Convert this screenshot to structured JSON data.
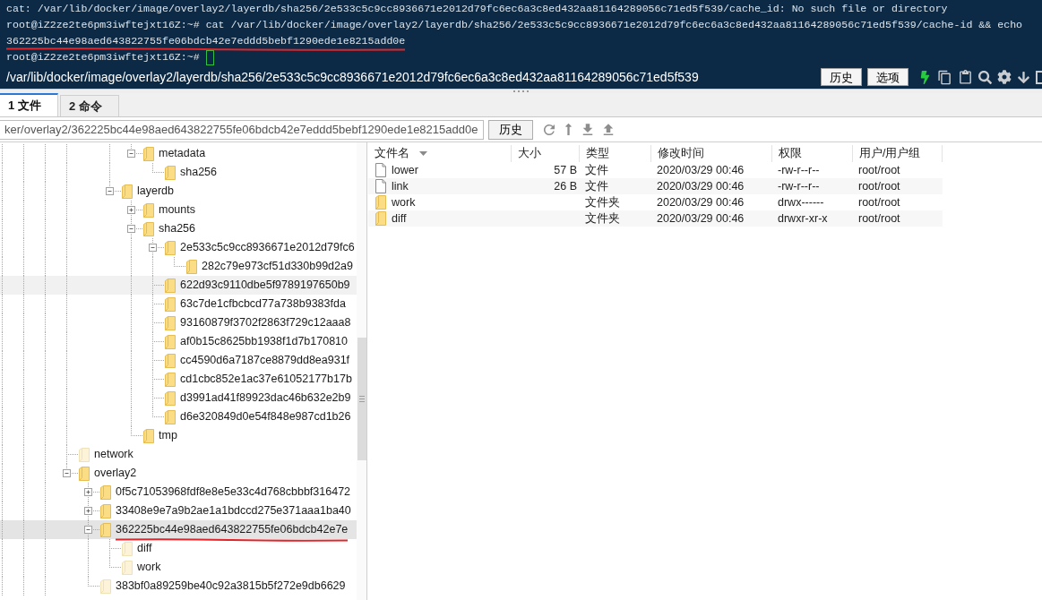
{
  "terminal": {
    "lines": [
      {
        "text": "cat: /var/lib/docker/image/overlay2/layerdb/sha256/2e533c5c9cc8936671e2012d79fc6ec6a3c8ed432aa81164289056c71ed5f539/cache_id: No such file or directory",
        "underlined": false
      },
      {
        "text": "root@iZ2ze2te6pm3iwftejxt16Z:~# cat /var/lib/docker/image/overlay2/layerdb/sha256/2e533c5c9cc8936671e2012d79fc6ec6a3c8ed432aa81164289056c71ed5f539/cache-id && echo",
        "underlined": false
      },
      {
        "text": "362225bc44e98aed643822755fe06bdcb42e7eddd5bebf1290ede1e8215add0e",
        "underlined": true
      },
      {
        "text": "root@iZ2ze2te6pm3iwftejxt16Z:~#",
        "underlined": false
      }
    ],
    "cursor": true,
    "path": "/var/lib/docker/image/overlay2/layerdb/sha256/2e533c5c9cc8936671e2012d79fc6ec6a3c8ed432aa81164289056c71ed5f539",
    "buttons": [
      "历史",
      "选项"
    ]
  },
  "tabs": [
    {
      "label": "1 文件",
      "selected": true
    },
    {
      "label": "2 命令",
      "selected": false
    }
  ],
  "path_bar": {
    "value": "ker/overlay2/362225bc44e98aed643822755fe06bdcb42e7eddd5bebf1290ede1e8215add0e",
    "button": "历史"
  },
  "tree": [
    {
      "children": [
        {
          "children": [
            {
              "children": [
                {
                  "label": "metadata",
                  "expanded": true,
                  "faded": false,
                  "selected": false,
                  "hovered": false,
                  "underlined": false,
                  "children": [
                    {
                      "label": "sha256",
                      "faded": false,
                      "selected": false,
                      "hovered": false,
                      "underlined": false
                    }
                  ]
                }
              ]
            },
            {
              "label": "layerdb",
              "expanded": true,
              "faded": false,
              "selected": false,
              "hovered": false,
              "underlined": false,
              "children": [
                {
                  "label": "mounts",
                  "expanded": false,
                  "faded": false,
                  "selected": false,
                  "hovered": false,
                  "underlined": false
                },
                {
                  "label": "sha256",
                  "expanded": true,
                  "faded": false,
                  "selected": false,
                  "hovered": false,
                  "underlined": false,
                  "children": [
                    {
                      "label": "2e533c5c9cc8936671e2012d79fc6",
                      "expanded": true,
                      "faded": false,
                      "selected": false,
                      "hovered": false,
                      "underlined": false,
                      "children": [
                        {
                          "label": "282c79e973cf51d330b99d2a9",
                          "faded": false,
                          "selected": false,
                          "hovered": false,
                          "underlined": false
                        }
                      ]
                    },
                    {
                      "label": "622d93c9110dbe5f9789197650b9",
                      "faded": false,
                      "selected": false,
                      "hovered": true,
                      "underlined": false
                    },
                    {
                      "label": "63c7de1cfbcbcd77a738b9383fda",
                      "faded": false,
                      "selected": false,
                      "hovered": false,
                      "underlined": false
                    },
                    {
                      "label": "93160879f3702f2863f729c12aaa8",
                      "faded": false,
                      "selected": false,
                      "hovered": false,
                      "underlined": false
                    },
                    {
                      "label": "af0b15c8625bb1938f1d7b170810",
                      "faded": false,
                      "selected": false,
                      "hovered": false,
                      "underlined": false
                    },
                    {
                      "label": "cc4590d6a7187ce8879dd8ea931f",
                      "faded": false,
                      "selected": false,
                      "hovered": false,
                      "underlined": false
                    },
                    {
                      "label": "cd1cbc852e1ac37e61052177b17b",
                      "faded": false,
                      "selected": false,
                      "hovered": false,
                      "underlined": false
                    },
                    {
                      "label": "d3991ad41f89923dac46b632e2b9",
                      "faded": false,
                      "selected": false,
                      "hovered": false,
                      "underlined": false
                    },
                    {
                      "label": "d6e320849d0e54f848e987cd1b26",
                      "faded": false,
                      "selected": false,
                      "hovered": false,
                      "underlined": false
                    }
                  ]
                },
                {
                  "label": "tmp",
                  "faded": false,
                  "selected": false,
                  "hovered": false,
                  "underlined": false
                }
              ]
            }
          ]
        }
      ]
    },
    {
      "label": "network",
      "faded": true,
      "selected": false,
      "hovered": false,
      "underlined": false
    },
    {
      "label": "overlay2",
      "expanded": true,
      "faded": false,
      "selected": false,
      "hovered": false,
      "underlined": false,
      "children": [
        {
          "label": "0f5c71053968fdf8e8e5e33c4d768cbbbf316472",
          "expanded": false,
          "faded": false,
          "selected": false,
          "hovered": false,
          "underlined": false
        },
        {
          "label": "33408e9e7a9b2ae1a1bdccd275e371aaa1ba40",
          "expanded": false,
          "faded": false,
          "selected": false,
          "hovered": false,
          "underlined": false
        },
        {
          "label": "362225bc44e98aed643822755fe06bdcb42e7e",
          "expanded": true,
          "faded": false,
          "selected": true,
          "hovered": false,
          "underlined": true,
          "children": [
            {
              "label": "diff",
              "faded": true,
              "selected": false,
              "hovered": false,
              "underlined": false
            },
            {
              "label": "work",
              "faded": true,
              "selected": false,
              "hovered": false,
              "underlined": false
            }
          ]
        },
        {
          "label": "383bf0a89259be40c92a3815b5f272e9db6629",
          "faded": true,
          "selected": false,
          "hovered": false,
          "underlined": false
        }
      ]
    }
  ],
  "files": {
    "columns": [
      {
        "label": "文件名",
        "sorted": true
      },
      {
        "label": "大小",
        "sorted": false
      },
      {
        "label": "类型",
        "sorted": false
      },
      {
        "label": "修改时间",
        "sorted": false
      },
      {
        "label": "权限",
        "sorted": false
      },
      {
        "label": "用户/用户组",
        "sorted": false
      }
    ],
    "rows": [
      {
        "kind": "file",
        "name": "lower",
        "size": "57 B",
        "type": "文件",
        "modified": "2020/03/29 00:46",
        "permissions": "-rw-r--r--",
        "owner": "root/root"
      },
      {
        "kind": "file",
        "name": "link",
        "size": "26 B",
        "type": "文件",
        "modified": "2020/03/29 00:46",
        "permissions": "-rw-r--r--",
        "owner": "root/root"
      },
      {
        "kind": "folder",
        "name": "work",
        "type": "文件夹",
        "modified": "2020/03/29 00:46",
        "permissions": "drwx------",
        "owner": "root/root"
      },
      {
        "kind": "folder",
        "name": "diff",
        "type": "文件夹",
        "modified": "2020/03/29 00:46",
        "permissions": "drwxr-xr-x",
        "owner": "root/root"
      }
    ]
  }
}
